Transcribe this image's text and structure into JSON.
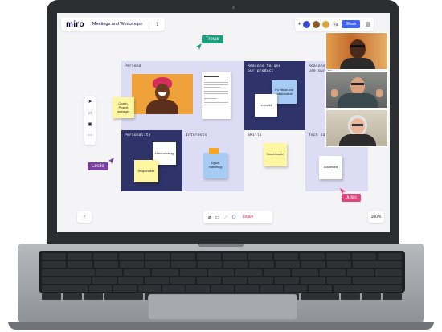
{
  "app": {
    "logo": "miro",
    "board_name": "Meetings and Workshops",
    "share_label": "Share",
    "participants_more": "+3",
    "zoom": "100%",
    "leave_label": "Leave"
  },
  "colors": {
    "frame_lavender": "#dcdcf5",
    "frame_navy": "#2e3369",
    "sticky_yellow": "#fff6a1",
    "sticky_blue": "#a6ccf5",
    "accent_blue": "#4262ff",
    "cursor_trevor": "#1a9e7d",
    "cursor_leslie": "#7b3fa0",
    "cursor_jules": "#e0447a"
  },
  "frames": {
    "persona": "Persona",
    "reasons": "Reasons to use our product",
    "reasons_cut": "Reasons to use our pro",
    "personality": "Personality",
    "interests": "Interests",
    "skills": "Skills",
    "tech": "Tech sav"
  },
  "stickies": {
    "coach": "Coach, Project manager",
    "visual": "It's visual and collaborative",
    "no_toolkit": "no toolkit",
    "hard_working": "Hard working",
    "responsible": "Responsible",
    "digital_marketing": "Digital marketing",
    "good_leader": "Good leader",
    "advanced": "Advanced"
  },
  "cursors": {
    "trevor": "Trevor",
    "leslie": "Leslie",
    "jules": "Jules"
  },
  "icons": {
    "upload": "upload-icon",
    "menu": "menu-icon",
    "select": "cursor-arrow-icon",
    "sticky": "sticky-note-icon",
    "comment": "comment-icon",
    "more": "more-icon",
    "mic": "mic-icon",
    "camera": "camera-icon",
    "share_screen": "share-screen-icon",
    "people": "people-icon"
  }
}
